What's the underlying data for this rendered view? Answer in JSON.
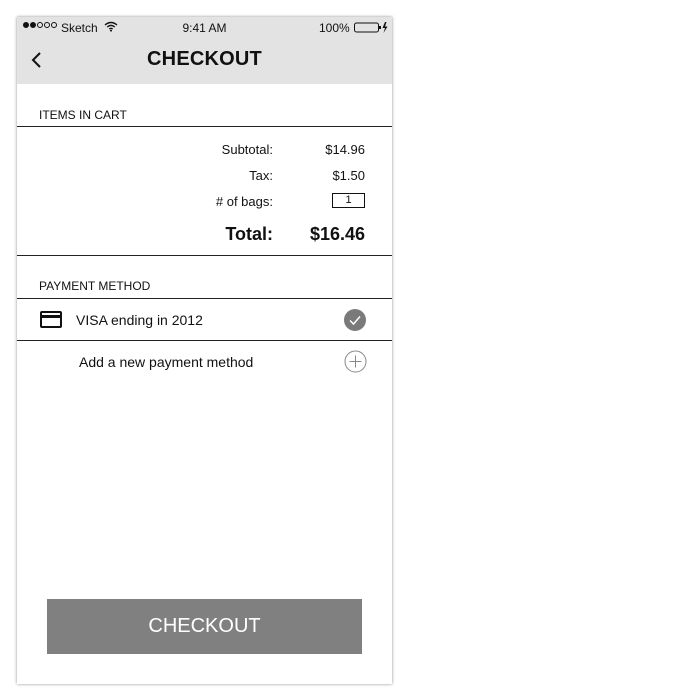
{
  "status_bar": {
    "signal_icon": "signal-dots-icon",
    "carrier": "Sketch",
    "wifi_icon": "wifi-icon",
    "time": "9:41 AM",
    "battery_percent": "100%",
    "battery_icon": "battery-charging-icon"
  },
  "header": {
    "back_icon": "chevron-left-icon",
    "title": "CHECKOUT"
  },
  "cart": {
    "heading": "ITEMS IN CART",
    "subtotal_label": "Subtotal:",
    "subtotal_value": "$14.96",
    "tax_label": "Tax:",
    "tax_value": "$1.50",
    "bags_label": "# of bags:",
    "bags_value": "1",
    "total_label": "Total:",
    "total_value": "$16.46"
  },
  "payment": {
    "heading": "PAYMENT METHOD",
    "methods": [
      {
        "icon": "credit-card-icon",
        "label": "VISA ending in 2012",
        "status_icon": "checkmark-circle-icon",
        "selected": true
      }
    ],
    "add_label": "Add a new payment method",
    "add_icon": "plus-circle-icon"
  },
  "footer": {
    "checkout_label": "CHECKOUT"
  },
  "colors": {
    "header_bg": "#e3e3e3",
    "button_bg": "#808080",
    "check_fill": "#7a7a7a"
  }
}
